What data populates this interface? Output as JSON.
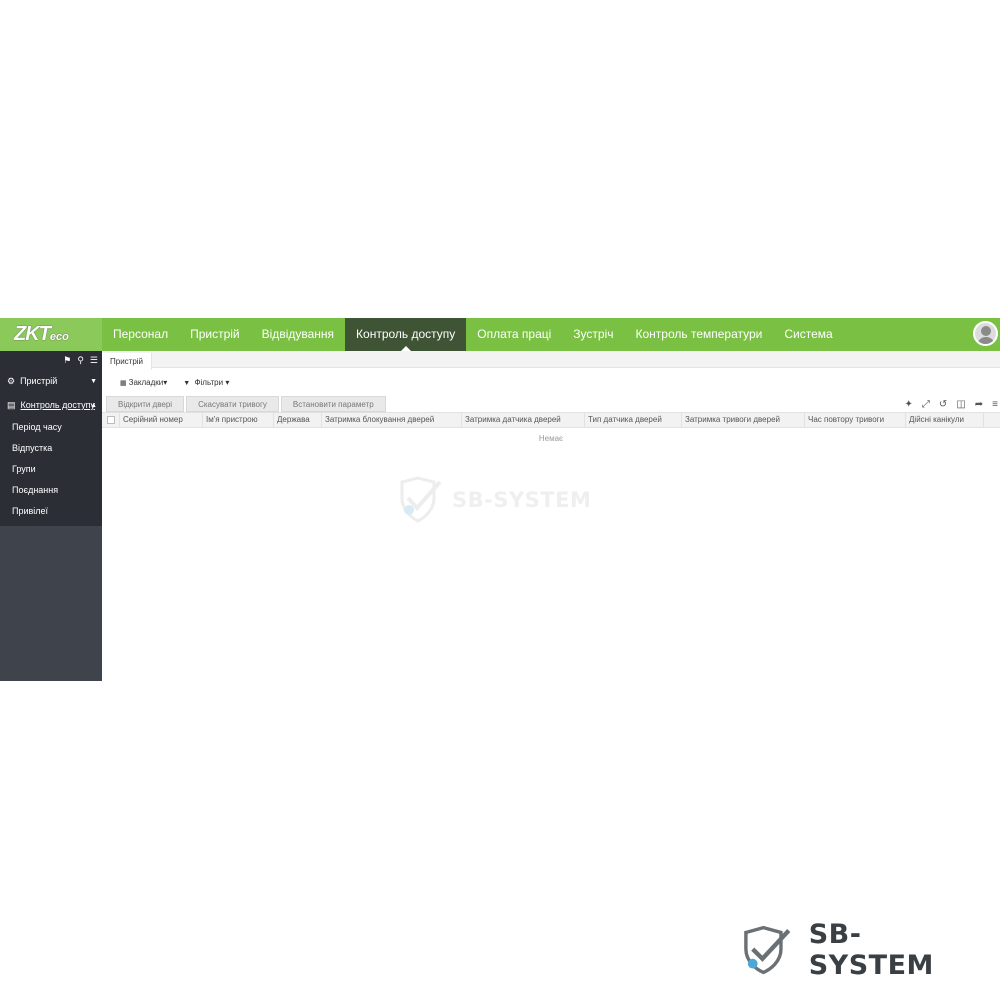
{
  "logo": {
    "main": "ZKT",
    "suffix": "eco"
  },
  "nav": {
    "items": [
      {
        "label": "Персонал"
      },
      {
        "label": "Пристрій"
      },
      {
        "label": "Відвідування"
      },
      {
        "label": "Контроль доступу",
        "active": true
      },
      {
        "label": "Оплата праці"
      },
      {
        "label": "Зустріч"
      },
      {
        "label": "Контроль температури"
      },
      {
        "label": "Система"
      }
    ]
  },
  "sidebar": {
    "tool_icons": [
      "tags-icon",
      "search-icon",
      "list-icon"
    ],
    "groups": [
      {
        "label": "Пристрій",
        "icon": "devices-icon",
        "expanded": false
      },
      {
        "label": "Контроль доступу",
        "icon": "calendar-icon",
        "expanded": true
      }
    ],
    "sub_items": [
      {
        "label": "Період часу"
      },
      {
        "label": "Відпустка"
      },
      {
        "label": "Групи"
      },
      {
        "label": "Поєднання"
      },
      {
        "label": "Привілеї"
      }
    ]
  },
  "main": {
    "tab": "Пристрій",
    "filters": {
      "bookmarks": "Закладки",
      "filters": "Фільтри"
    },
    "actions": [
      {
        "label": "Відкрити двері"
      },
      {
        "label": "Скасувати тривогу"
      },
      {
        "label": "Встановити параметр"
      }
    ],
    "tool_icons": [
      "magic-wand-icon",
      "expand-icon",
      "refresh-icon",
      "columns-icon",
      "share-icon",
      "menu-icon"
    ],
    "table": {
      "columns": [
        "Серійний номер",
        "Ім'я пристрою",
        "Держава",
        "Затримка блокування дверей",
        "Затримка датчика дверей",
        "Тип датчика дверей",
        "Затримка тривоги дверей",
        "Час повтору тривоги",
        "Дійсні канікули"
      ],
      "rows": [],
      "empty_text": "Немає"
    }
  },
  "watermark": {
    "text": "SB-SYSTEM"
  },
  "colors": {
    "nav_bg": "#7ac143",
    "nav_active": "#3e5434",
    "sidebar_bg": "#3f434c",
    "sidebar_dark": "#2b2e34"
  }
}
